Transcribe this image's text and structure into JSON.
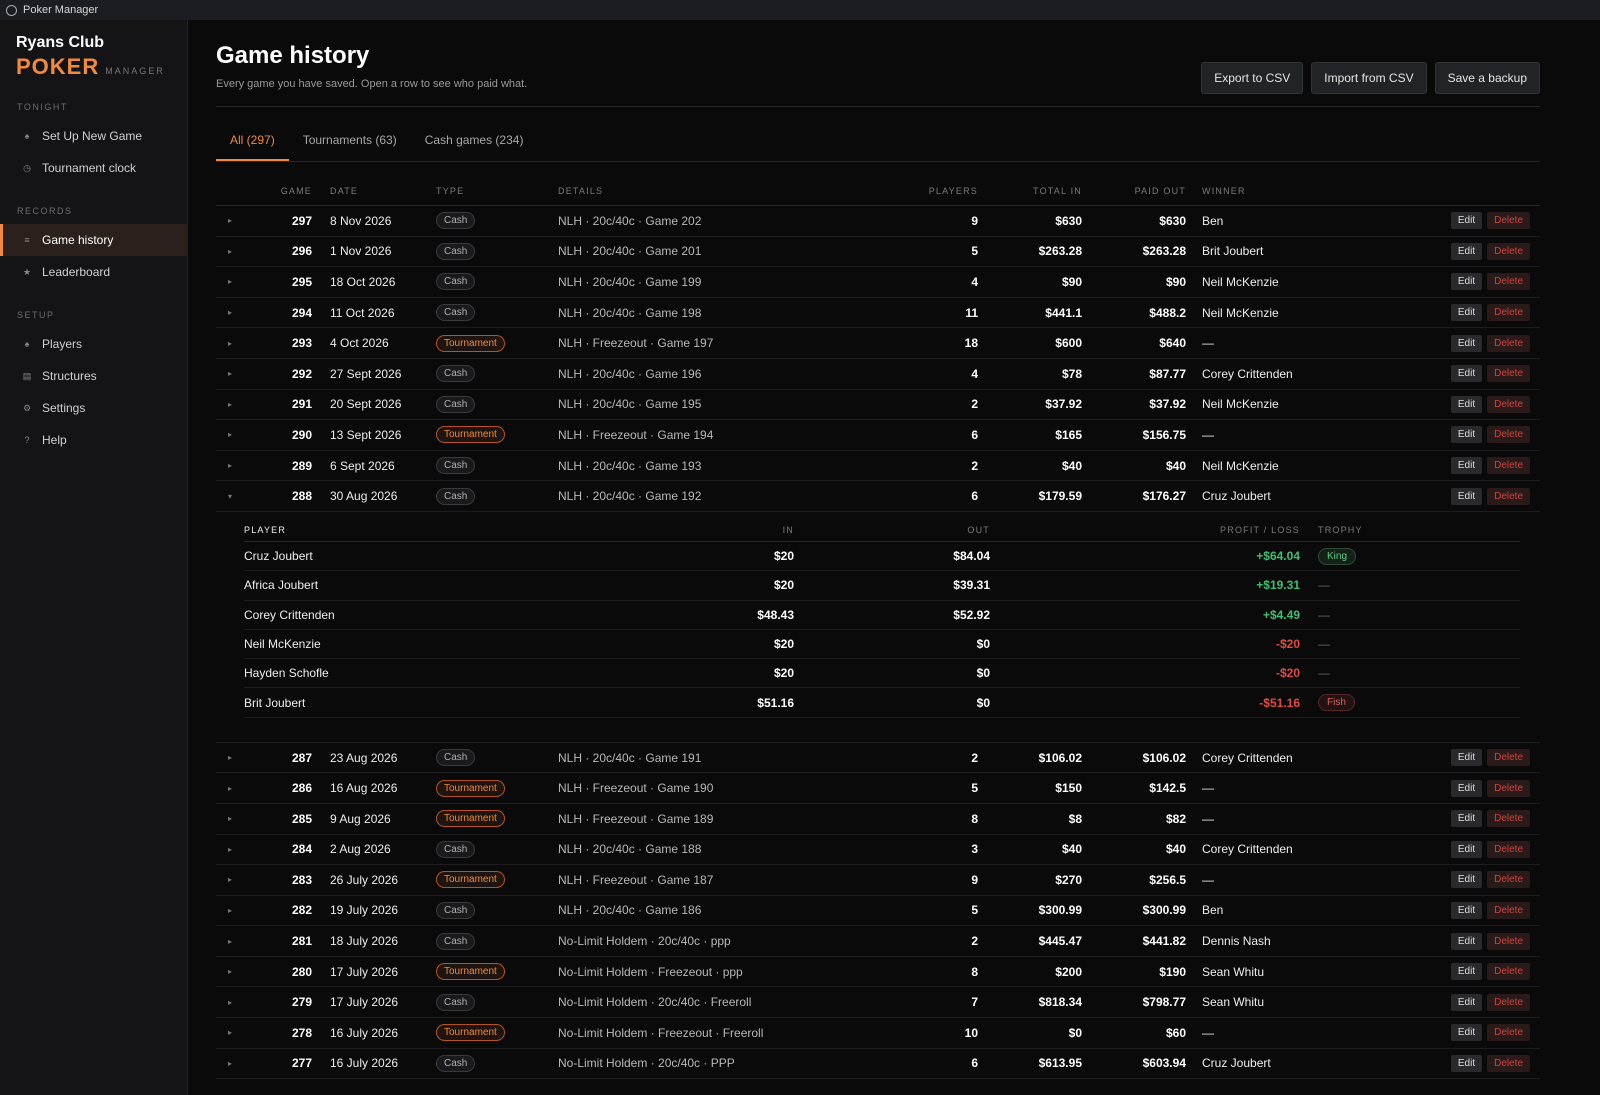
{
  "window": {
    "title": "Poker Manager"
  },
  "brand": {
    "club": "Ryans Club",
    "poker": "POKER",
    "manager": "MANAGER"
  },
  "sidebar": {
    "sections": [
      {
        "label": "TONIGHT",
        "items": [
          {
            "label": "Set Up New Game",
            "icon": "spade-icon"
          },
          {
            "label": "Tournament clock",
            "icon": "clock-icon"
          }
        ]
      },
      {
        "label": "RECORDS",
        "items": [
          {
            "label": "Game history",
            "icon": "list-icon",
            "active": true
          },
          {
            "label": "Leaderboard",
            "icon": "star-icon"
          }
        ]
      },
      {
        "label": "SETUP",
        "items": [
          {
            "label": "Players",
            "icon": "spade-icon"
          },
          {
            "label": "Structures",
            "icon": "grid-icon"
          },
          {
            "label": "Settings",
            "icon": "gear-icon"
          },
          {
            "label": "Help",
            "icon": "help-icon"
          }
        ]
      }
    ]
  },
  "header": {
    "title": "Game history",
    "subtitle": "Every game you have saved. Open a row to see who paid what.",
    "buttons": {
      "export": "Export to CSV",
      "import": "Import from CSV",
      "backup": "Save a backup"
    }
  },
  "tabs": [
    {
      "label": "All (297)",
      "active": true
    },
    {
      "label": "Tournaments (63)"
    },
    {
      "label": "Cash games (234)"
    }
  ],
  "columns": {
    "game": "GAME",
    "date": "DATE",
    "type": "TYPE",
    "details": "DETAILS",
    "players": "PLAYERS",
    "total_in": "TOTAL IN",
    "paid_out": "PAID OUT",
    "winner": "WINNER"
  },
  "actions": {
    "edit": "Edit",
    "delete": "Delete"
  },
  "games_before": [
    {
      "game": "297",
      "date": "8 Nov 2026",
      "type": "Cash",
      "details": "NLH · 20c/40c · Game 202",
      "players": "9",
      "total_in": "$630",
      "paid_out": "$630",
      "winner": "Ben"
    },
    {
      "game": "296",
      "date": "1 Nov 2026",
      "type": "Cash",
      "details": "NLH · 20c/40c · Game 201",
      "players": "5",
      "total_in": "$263.28",
      "paid_out": "$263.28",
      "winner": "Brit Joubert"
    },
    {
      "game": "295",
      "date": "18 Oct 2026",
      "type": "Cash",
      "details": "NLH · 20c/40c · Game 199",
      "players": "4",
      "total_in": "$90",
      "paid_out": "$90",
      "winner": "Neil McKenzie"
    },
    {
      "game": "294",
      "date": "11 Oct 2026",
      "type": "Cash",
      "details": "NLH · 20c/40c · Game 198",
      "players": "11",
      "total_in": "$441.1",
      "paid_out": "$488.2",
      "winner": "Neil McKenzie"
    },
    {
      "game": "293",
      "date": "4 Oct 2026",
      "type": "Tournament",
      "details": "NLH · Freezeout · Game 197",
      "players": "18",
      "total_in": "$600",
      "paid_out": "$640",
      "winner": "—"
    },
    {
      "game": "292",
      "date": "27 Sept 2026",
      "type": "Cash",
      "details": "NLH · 20c/40c · Game 196",
      "players": "4",
      "total_in": "$78",
      "paid_out": "$87.77",
      "winner": "Corey Crittenden"
    },
    {
      "game": "291",
      "date": "20 Sept 2026",
      "type": "Cash",
      "details": "NLH · 20c/40c · Game 195",
      "players": "2",
      "total_in": "$37.92",
      "paid_out": "$37.92",
      "winner": "Neil McKenzie"
    },
    {
      "game": "290",
      "date": "13 Sept 2026",
      "type": "Tournament",
      "details": "NLH · Freezeout · Game 194",
      "players": "6",
      "total_in": "$165",
      "paid_out": "$156.75",
      "winner": "—"
    },
    {
      "game": "289",
      "date": "6 Sept 2026",
      "type": "Cash",
      "details": "NLH · 20c/40c · Game 193",
      "players": "2",
      "total_in": "$40",
      "paid_out": "$40",
      "winner": "Neil McKenzie"
    },
    {
      "game": "288",
      "date": "30 Aug 2026",
      "type": "Cash",
      "details": "NLH · 20c/40c · Game 192",
      "players": "6",
      "total_in": "$179.59",
      "paid_out": "$176.27",
      "winner": "Cruz Joubert",
      "expanded": true
    }
  ],
  "detail": {
    "columns": {
      "player": "PLAYER",
      "in": "IN",
      "out": "OUT",
      "pl": "PROFIT / LOSS",
      "trophy": "TROPHY"
    },
    "rows": [
      {
        "player": "Cruz Joubert",
        "in": "$20",
        "out": "$84.04",
        "pl": "+$64.04",
        "sign": "pos",
        "trophy": "King"
      },
      {
        "player": "Africa Joubert",
        "in": "$20",
        "out": "$39.31",
        "pl": "+$19.31",
        "sign": "pos",
        "trophy": "—"
      },
      {
        "player": "Corey Crittenden",
        "in": "$48.43",
        "out": "$52.92",
        "pl": "+$4.49",
        "sign": "pos",
        "trophy": "—"
      },
      {
        "player": "Neil McKenzie",
        "in": "$20",
        "out": "$0",
        "pl": "-$20",
        "sign": "neg",
        "trophy": "—"
      },
      {
        "player": "Hayden Schofle",
        "in": "$20",
        "out": "$0",
        "pl": "-$20",
        "sign": "neg",
        "trophy": "—"
      },
      {
        "player": "Brit Joubert",
        "in": "$51.16",
        "out": "$0",
        "pl": "-$51.16",
        "sign": "neg",
        "trophy": "Fish"
      }
    ]
  },
  "games_after": [
    {
      "game": "287",
      "date": "23 Aug 2026",
      "type": "Cash",
      "details": "NLH · 20c/40c · Game 191",
      "players": "2",
      "total_in": "$106.02",
      "paid_out": "$106.02",
      "winner": "Corey Crittenden"
    },
    {
      "game": "286",
      "date": "16 Aug 2026",
      "type": "Tournament",
      "details": "NLH · Freezeout · Game 190",
      "players": "5",
      "total_in": "$150",
      "paid_out": "$142.5",
      "winner": "—"
    },
    {
      "game": "285",
      "date": "9 Aug 2026",
      "type": "Tournament",
      "details": "NLH · Freezeout · Game 189",
      "players": "8",
      "total_in": "$8",
      "paid_out": "$82",
      "winner": "—"
    },
    {
      "game": "284",
      "date": "2 Aug 2026",
      "type": "Cash",
      "details": "NLH · 20c/40c · Game 188",
      "players": "3",
      "total_in": "$40",
      "paid_out": "$40",
      "winner": "Corey Crittenden"
    },
    {
      "game": "283",
      "date": "26 July 2026",
      "type": "Tournament",
      "details": "NLH · Freezeout · Game 187",
      "players": "9",
      "total_in": "$270",
      "paid_out": "$256.5",
      "winner": "—"
    },
    {
      "game": "282",
      "date": "19 July 2026",
      "type": "Cash",
      "details": "NLH · 20c/40c · Game 186",
      "players": "5",
      "total_in": "$300.99",
      "paid_out": "$300.99",
      "winner": "Ben"
    },
    {
      "game": "281",
      "date": "18 July 2026",
      "type": "Cash",
      "details": "No-Limit Holdem · 20c/40c · ppp",
      "players": "2",
      "total_in": "$445.47",
      "paid_out": "$441.82",
      "winner": "Dennis Nash"
    },
    {
      "game": "280",
      "date": "17 July 2026",
      "type": "Tournament",
      "details": "No-Limit Holdem · Freezeout · ppp",
      "players": "8",
      "total_in": "$200",
      "paid_out": "$190",
      "winner": "Sean Whitu"
    },
    {
      "game": "279",
      "date": "17 July 2026",
      "type": "Cash",
      "details": "No-Limit Holdem · 20c/40c · Freeroll",
      "players": "7",
      "total_in": "$818.34",
      "paid_out": "$798.77",
      "winner": "Sean Whitu"
    },
    {
      "game": "278",
      "date": "16 July 2026",
      "type": "Tournament",
      "details": "No-Limit Holdem · Freezeout · Freeroll",
      "players": "10",
      "total_in": "$0",
      "paid_out": "$60",
      "winner": "—"
    },
    {
      "game": "277",
      "date": "16 July 2026",
      "type": "Cash",
      "details": "No-Limit Holdem · 20c/40c · PPP",
      "players": "6",
      "total_in": "$613.95",
      "paid_out": "$603.94",
      "winner": "Cruz Joubert"
    }
  ]
}
